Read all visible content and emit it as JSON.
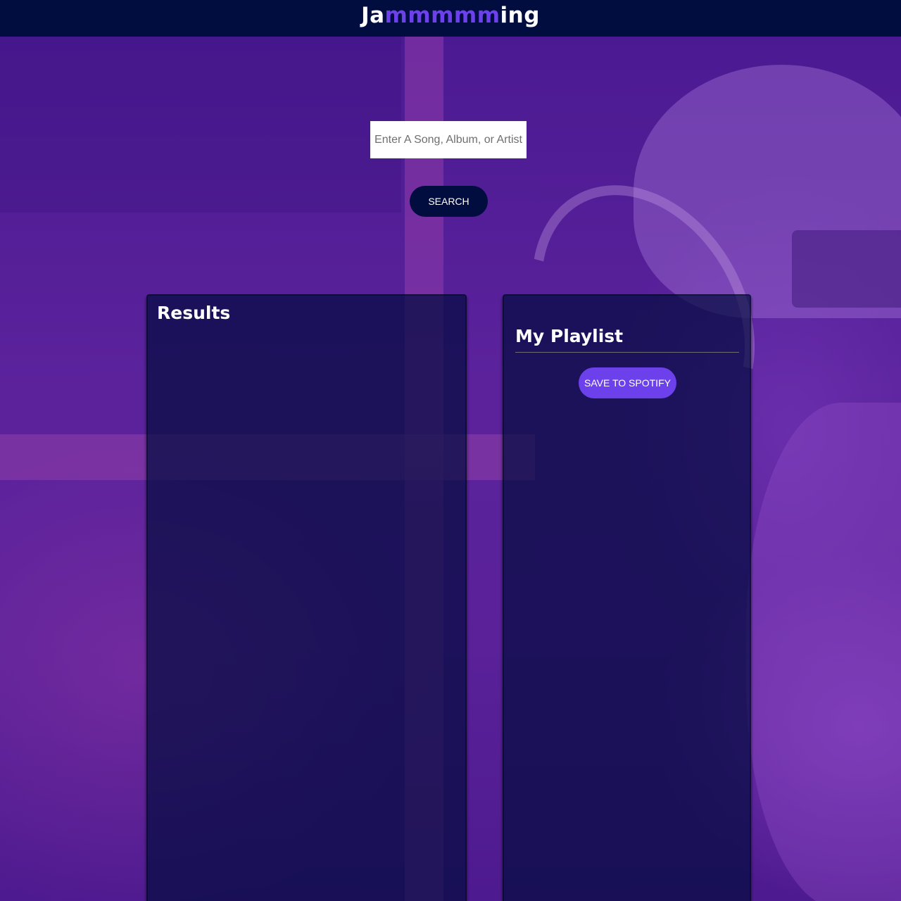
{
  "header": {
    "logo_prefix": "Ja",
    "logo_highlight": "mmmmm",
    "logo_suffix": "ing"
  },
  "search": {
    "placeholder": "Enter A Song, Album, or Artist",
    "value": "",
    "button_label": "SEARCH"
  },
  "results": {
    "title": "Results",
    "tracks": []
  },
  "playlist": {
    "name": "My Playlist",
    "tracks": [],
    "save_label": "SAVE TO SPOTIFY"
  },
  "colors": {
    "header_bg": "#010c3f",
    "accent": "#6c41ec",
    "background": "#5a2199"
  }
}
